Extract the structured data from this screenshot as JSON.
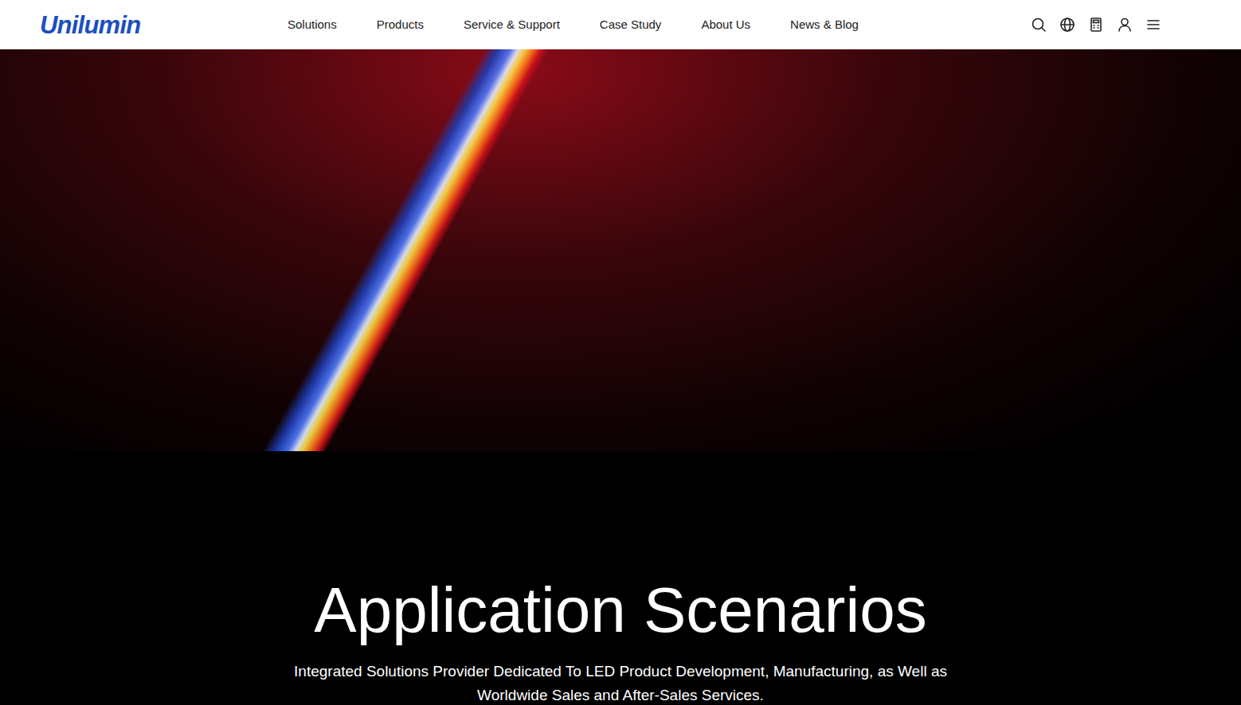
{
  "logo": "Unilumin",
  "nav": [
    "Solutions",
    "Products",
    "Service & Support",
    "Case Study",
    "About Us",
    "News & Blog"
  ],
  "section": {
    "title": "Application Scenarios",
    "subtitle": "Integrated Solutions Provider Dedicated To LED Product Development, Manufacturing, as Well as Worldwide Sales and After-Sales Services."
  }
}
